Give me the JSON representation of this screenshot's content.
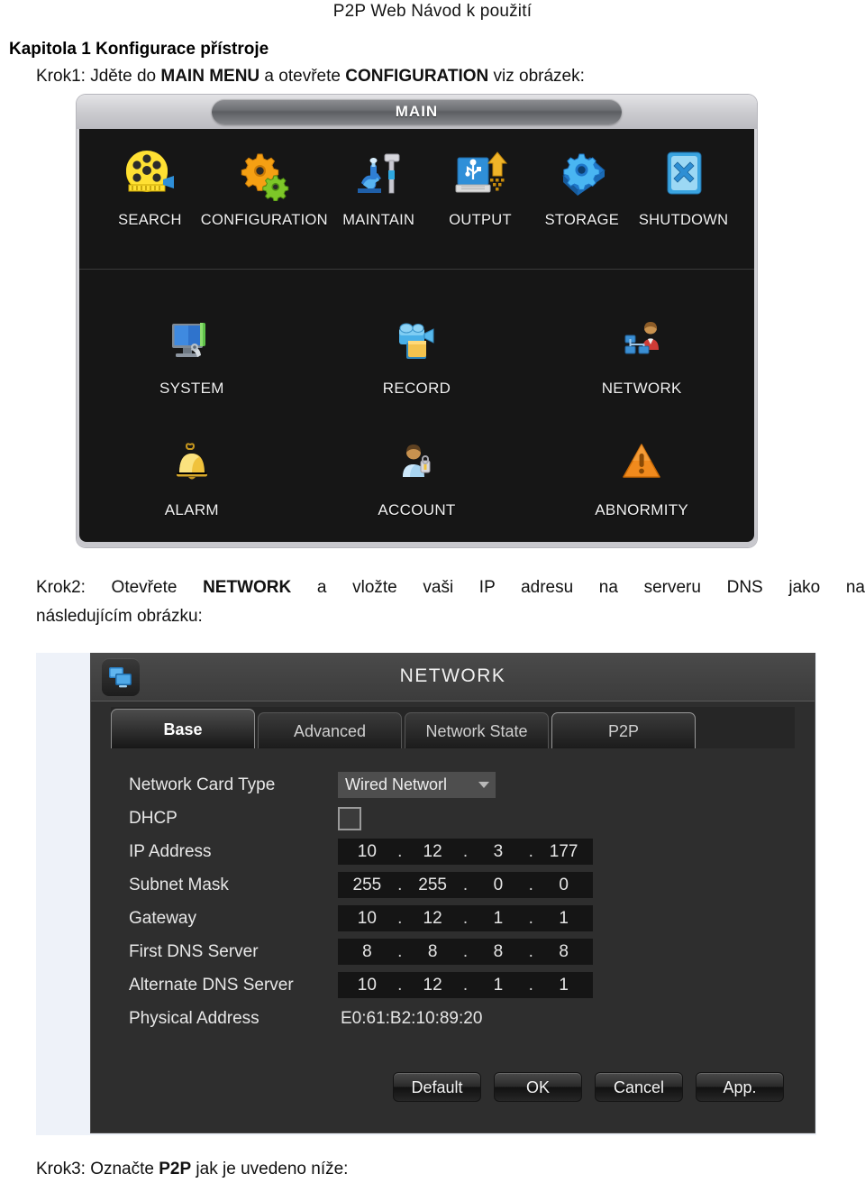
{
  "document": {
    "header": "P2P Web Návod k použití",
    "chapter_title": "Kapitola 1 Konfigurace přístroje",
    "step1": {
      "prefix": "Krok1: Jděte do ",
      "bold1": "MAIN MENU",
      "middle": " a otevřete ",
      "bold2": "CONFIGURATION",
      "suffix": " viz obrázek:"
    },
    "step2": {
      "prefix": "Krok2: Otevřete ",
      "bold1": "NETWORK",
      "suffix": " a vložte vaši IP adresu na serveru DNS jako na",
      "line2": "následujícím obrázku:"
    },
    "step3": {
      "prefix": "Krok3: Označte ",
      "bold1": "P2P",
      "suffix": " jak je uvedeno níže:"
    }
  },
  "main_menu": {
    "title": "MAIN",
    "row_top": [
      {
        "label": "SEARCH",
        "icon": "film-reel-icon"
      },
      {
        "label": "CONFIGURATION",
        "icon": "gears-icon"
      },
      {
        "label": "MAINTAIN",
        "icon": "tools-icon"
      },
      {
        "label": "OUTPUT",
        "icon": "usb-backup-icon"
      },
      {
        "label": "STORAGE",
        "icon": "hdd-gear-icon"
      },
      {
        "label": "SHUTDOWN",
        "icon": "shutdown-x-icon"
      }
    ],
    "row_mid": [
      {
        "label": "SYSTEM",
        "icon": "monitor-wrench-icon"
      },
      {
        "label": "RECORD",
        "icon": "camcorder-icon"
      },
      {
        "label": "NETWORK",
        "icon": "network-user-icon"
      }
    ],
    "row_bot": [
      {
        "label": "ALARM",
        "icon": "bell-icon"
      },
      {
        "label": "ACCOUNT",
        "icon": "user-key-icon"
      },
      {
        "label": "ABNORMITY",
        "icon": "warning-triangle-icon"
      }
    ]
  },
  "network_dialog": {
    "title": "NETWORK",
    "window_icon": "network-screens-icon",
    "tabs": [
      {
        "label": "Base",
        "active": true
      },
      {
        "label": "Advanced",
        "active": false
      },
      {
        "label": "Network State",
        "active": false
      },
      {
        "label": "P2P",
        "active": false
      }
    ],
    "fields": {
      "card_type_label": "Network Card Type",
      "card_type_value": "Wired Networl",
      "dhcp_label": "DHCP",
      "dhcp_checked": false,
      "ip_label": "IP Address",
      "ip_value": [
        "10",
        "12",
        "3",
        "177"
      ],
      "mask_label": "Subnet Mask",
      "mask_value": [
        "255",
        "255",
        "0",
        "0"
      ],
      "gateway_label": "Gateway",
      "gateway_value": [
        "10",
        "12",
        "1",
        "1"
      ],
      "dns1_label": "First DNS Server",
      "dns1_value": [
        "8",
        "8",
        "8",
        "8"
      ],
      "dns2_label": "Alternate DNS Server",
      "dns2_value": [
        "10",
        "12",
        "1",
        "1"
      ],
      "mac_label": "Physical Address",
      "mac_value": "E0:61:B2:10:89:20"
    },
    "buttons": [
      {
        "label": "Default"
      },
      {
        "label": "OK"
      },
      {
        "label": "Cancel"
      },
      {
        "label": "App."
      }
    ]
  },
  "colors": {
    "page_bg": "#ffffff",
    "dialog_dark": "#161616",
    "dialog_gray": "#2e2e2e",
    "panel_light": "#eef2f9",
    "label_text": "#e8e8e8"
  }
}
